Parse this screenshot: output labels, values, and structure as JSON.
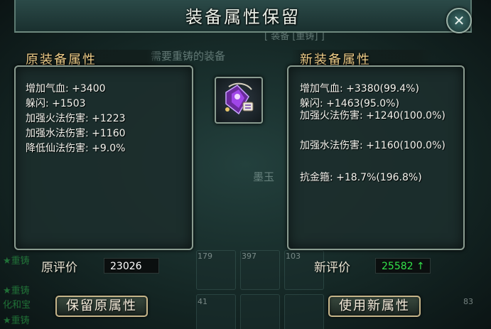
{
  "dialog": {
    "title": "装备属性保留",
    "close_icon": "close-icon"
  },
  "background": {
    "hint_text": "需要重铸的装备",
    "top_partial": "[ 装备 [重铸] ]",
    "item_name": "墨玉",
    "slot_counts": [
      "179",
      "397",
      "103"
    ],
    "bottom_counts": [
      "41",
      "83"
    ],
    "tips": [
      "★重铸",
      "★重铸",
      "★重铸"
    ],
    "tips_line": "化和宝"
  },
  "left_panel": {
    "title": "原装备属性",
    "stats": [
      "增加气血: +3400",
      "躲闪: +1503",
      "加强火法伤害: +1223",
      "加强水法伤害: +1160",
      "降低仙法伤害: +9.0%"
    ]
  },
  "right_panel": {
    "title": "新装备属性",
    "stats": [
      "增加气血: +3380(99.4%)",
      "躲闪: +1463(95.0%)",
      "加强火法伤害: +1240(100.0%)",
      "加强水法伤害: +1160(100.0%)",
      "抗金箍: +18.7%(196.8%)"
    ]
  },
  "scores": {
    "old_label": "原评价",
    "old_value": "23026",
    "new_label": "新评价",
    "new_value": "25582",
    "up_arrow": "↑",
    "old_color": "#ffffff",
    "new_color": "#33e24a"
  },
  "buttons": {
    "keep_old": "保留原属性",
    "use_new": "使用新属性"
  },
  "item": {
    "icon": "purple-gem-pendant-icon"
  }
}
